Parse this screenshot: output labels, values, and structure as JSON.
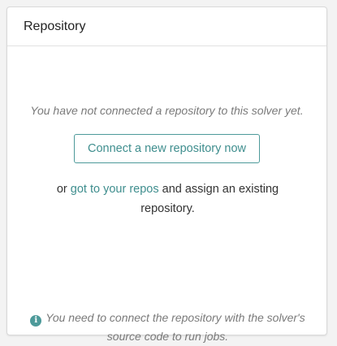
{
  "card": {
    "title": "Repository"
  },
  "empty_state": {
    "message": "You have not connected a repository to this solver yet.",
    "connect_button_label": "Connect a new repository now",
    "alt_prefix": "or ",
    "alt_link_label": "got to your repos",
    "alt_suffix": " and assign an existing repository."
  },
  "info": {
    "icon": "info-circle-icon",
    "icon_glyph": "i",
    "message": "You need to connect the repository with the solver's source code to run jobs."
  },
  "colors": {
    "accent": "#3f8e8e",
    "muted_text": "#7a7a7a",
    "background": "#f3f3f3"
  }
}
